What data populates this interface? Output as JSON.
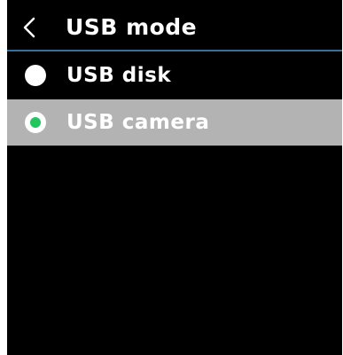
{
  "header": {
    "back_icon": "chevron-left-icon",
    "title": "USB mode"
  },
  "options": [
    {
      "label": "USB disk",
      "selected": false
    },
    {
      "label": "USB camera",
      "selected": true
    }
  ],
  "colors": {
    "screen_background": "#000000",
    "header_divider": "#3a6e9c",
    "selected_row": "#b3b3b3",
    "radio_selected_dot": "#22c55e",
    "text": "#ffffff"
  }
}
